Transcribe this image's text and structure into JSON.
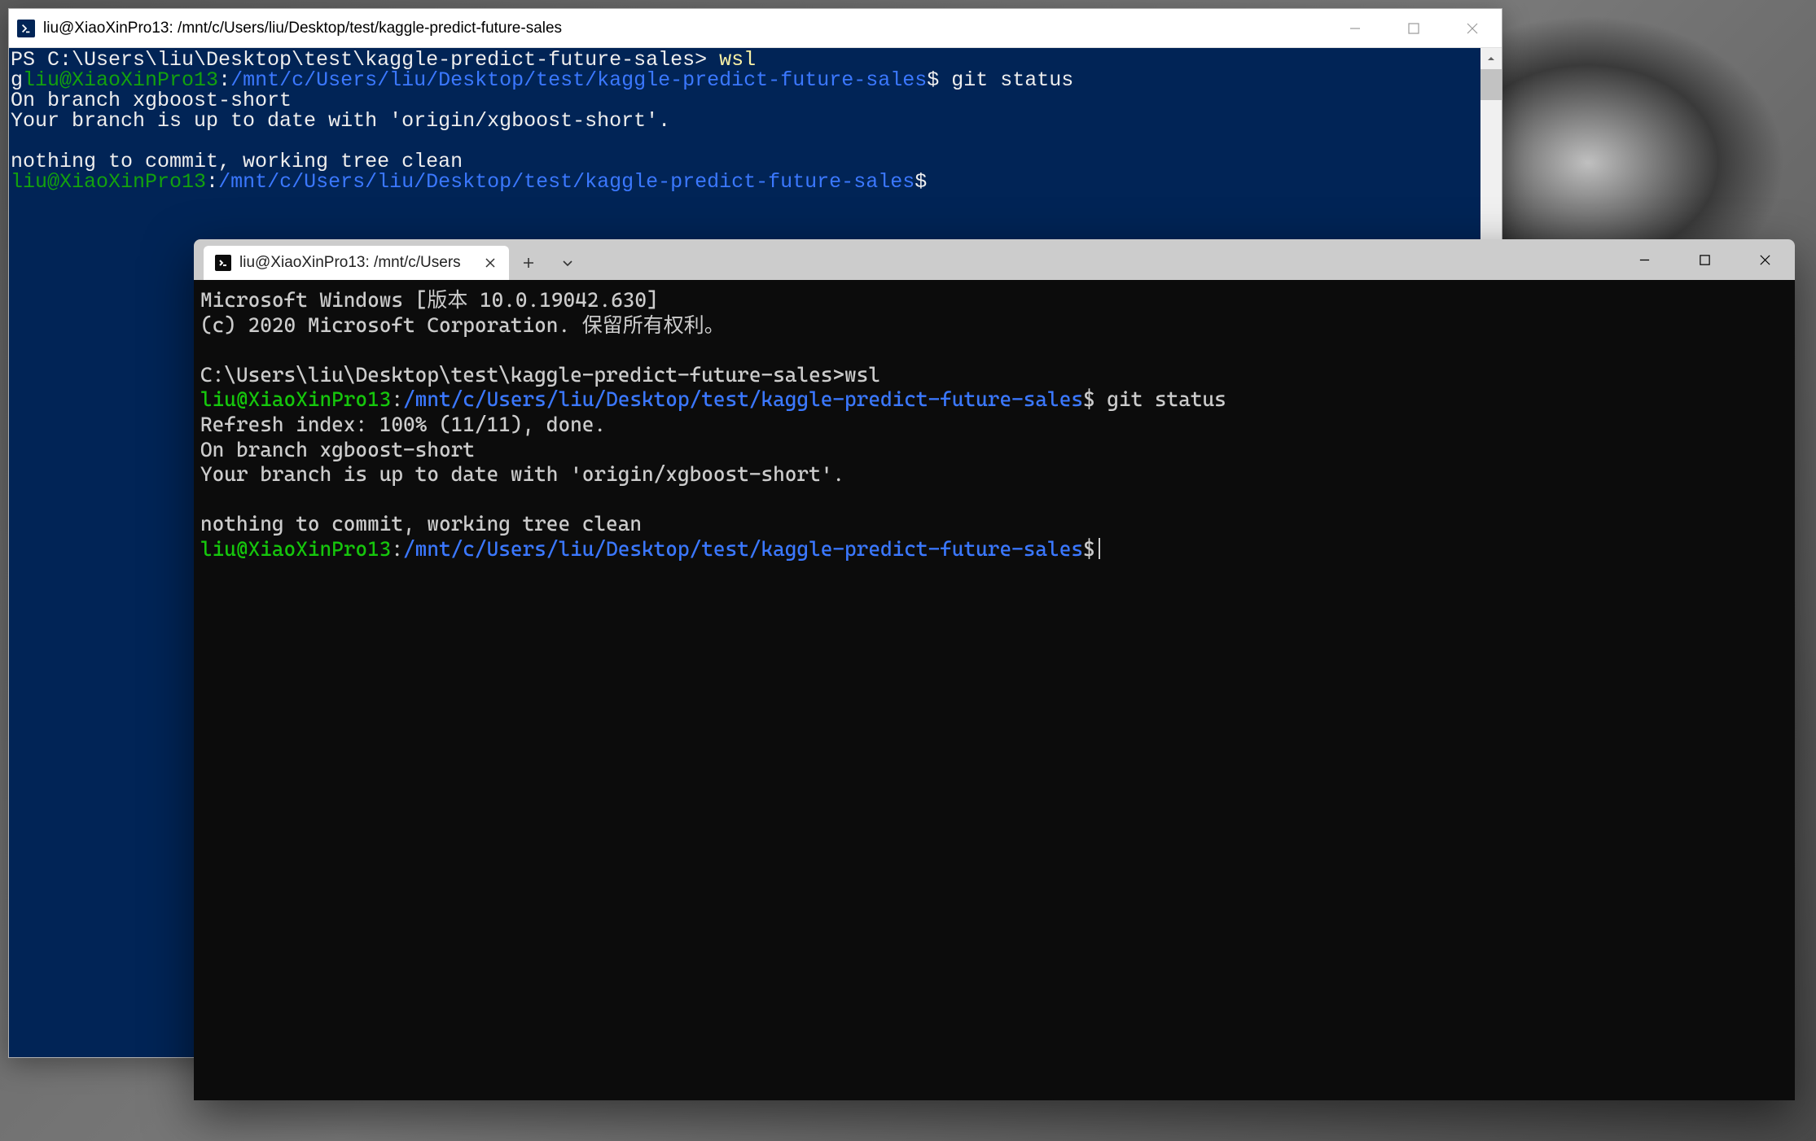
{
  "powershell": {
    "title": "liu@XiaoXinPro13: /mnt/c/Users/liu/Desktop/test/kaggle-predict-future-sales",
    "lines": {
      "ps_prompt": "PS C:\\Users\\liu\\Desktop\\test\\kaggle-predict-future-sales> ",
      "wsl_cmd": "wsl",
      "stray_g": "g",
      "userhost1": "liu@XiaoXinPro13",
      "colon": ":",
      "path1": "/mnt/c/Users/liu/Desktop/test/kaggle-predict-future-sales",
      "dollar": "$",
      "git_status_cmd": " git status",
      "branch_line": "On branch xgboost-short",
      "uptodate_line": "Your branch is up to date with 'origin/xgboost-short'.",
      "nothing_line": "nothing to commit, working tree clean",
      "userhost2": "liu@XiaoXinPro13",
      "path2": "/mnt/c/Users/liu/Desktop/test/kaggle-predict-future-sales"
    }
  },
  "terminal": {
    "tab_title": "liu@XiaoXinPro13: /mnt/c/Users",
    "lines": {
      "ms_line": "Microsoft Windows [版本 10.0.19042.630]",
      "copy_line": "(c) 2020 Microsoft Corporation. 保留所有权利。",
      "cmd_prompt": "C:\\Users\\liu\\Desktop\\test\\kaggle-predict-future-sales>",
      "wsl_cmd": "wsl",
      "userhost1": "liu@XiaoXinPro13",
      "colon": ":",
      "path1": "/mnt/c/Users/liu/Desktop/test/kaggle-predict-future-sales",
      "dollar": "$",
      "git_status_cmd": " git status",
      "refresh_line": "Refresh index: 100% (11/11), done.",
      "branch_line": "On branch xgboost-short",
      "uptodate_line": "Your branch is up to date with 'origin/xgboost-short'.",
      "nothing_line": "nothing to commit, working tree clean",
      "userhost2": "liu@XiaoXinPro13",
      "path2": "/mnt/c/Users/liu/Desktop/test/kaggle-predict-future-sales"
    }
  }
}
